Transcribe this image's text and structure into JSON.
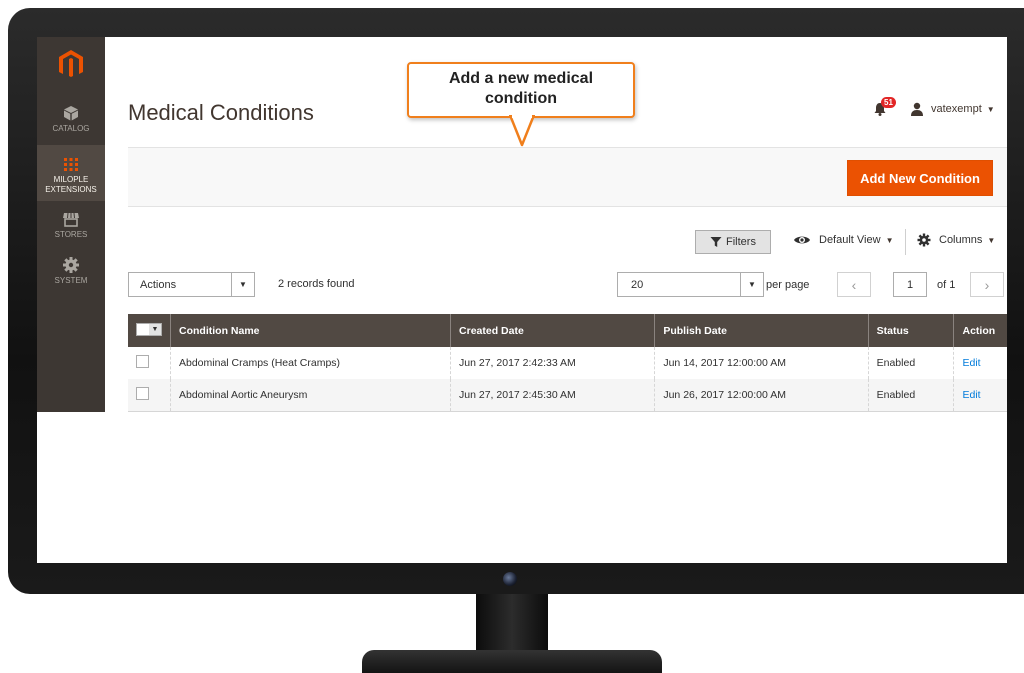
{
  "sidebar": {
    "items": [
      {
        "label": "CATALOG",
        "icon": "cube-icon"
      },
      {
        "label": "MILOPLE",
        "label2": "EXTENSIONS",
        "icon": "grid-icon"
      },
      {
        "label": "STORES",
        "icon": "store-icon"
      },
      {
        "label": "SYSTEM",
        "icon": "gear-icon"
      }
    ]
  },
  "header": {
    "title": "Medical Conditions",
    "notifications_count": "51",
    "username": "vatexempt"
  },
  "action_bar": {
    "add_button_label": "Add New Condition"
  },
  "controls": {
    "filters_label": "Filters",
    "view_label": "Default View",
    "columns_label": "Columns",
    "actions_label": "Actions",
    "records_found": "2 records found",
    "per_page_value": "20",
    "per_page_label": "per page",
    "page_number": "1",
    "page_of": "of 1"
  },
  "table": {
    "columns": [
      "Condition Name",
      "Created Date",
      "Publish Date",
      "Status",
      "Action"
    ],
    "rows": [
      {
        "name": "Abdominal Cramps (Heat Cramps)",
        "created": "Jun 27, 2017 2:42:33 AM",
        "published": "Jun 14, 2017 12:00:00 AM",
        "status": "Enabled",
        "action": "Edit"
      },
      {
        "name": "Abdominal Aortic Aneurysm",
        "created": "Jun 27, 2017 2:45:30 AM",
        "published": "Jun 26, 2017 12:00:00 AM",
        "status": "Enabled",
        "action": "Edit"
      }
    ]
  },
  "callout": {
    "line1": "Add a new medical",
    "line2": "condition"
  },
  "colors": {
    "accent": "#eb5202",
    "sidebar": "#3d3733",
    "table_header": "#514943",
    "callout_border": "#f07f1c",
    "link": "#007bdb"
  }
}
